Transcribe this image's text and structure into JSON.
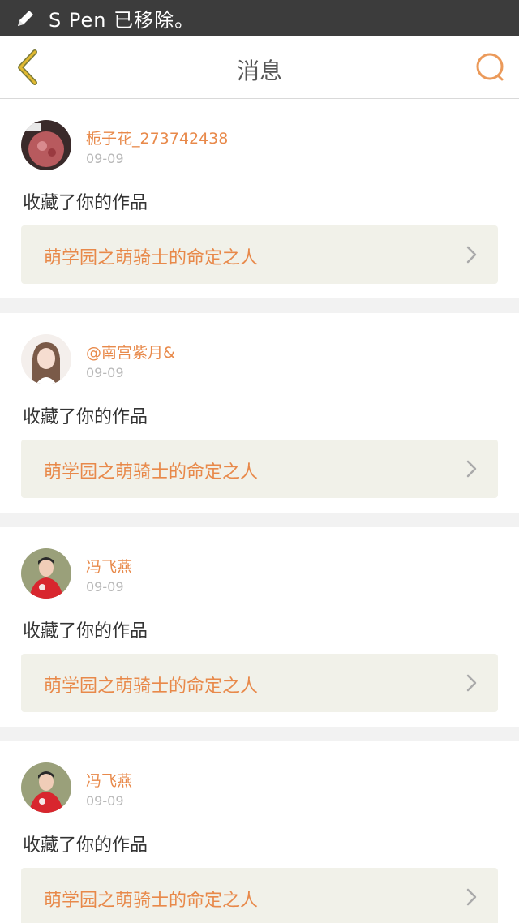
{
  "status_bar": {
    "icon": "pen-icon",
    "text": "S Pen 已移除。"
  },
  "header": {
    "title": "消息",
    "back_icon": "chevron-left-icon",
    "search_icon": "search-icon",
    "accent_color": "#e8894a"
  },
  "messages": [
    {
      "username": "栀子花_273742438",
      "date": "09-09",
      "action": "收藏了你的作品",
      "work_title": "萌学园之萌骑士的命定之人"
    },
    {
      "username": "@南宫紫月&",
      "date": "09-09",
      "action": "收藏了你的作品",
      "work_title": "萌学园之萌骑士的命定之人"
    },
    {
      "username": "冯飞燕",
      "date": "09-09",
      "action": "收藏了你的作品",
      "work_title": "萌学园之萌骑士的命定之人"
    },
    {
      "username": "冯飞燕",
      "date": "09-09",
      "action": "收藏了你的作品",
      "work_title": "萌学园之萌骑士的命定之人"
    }
  ]
}
